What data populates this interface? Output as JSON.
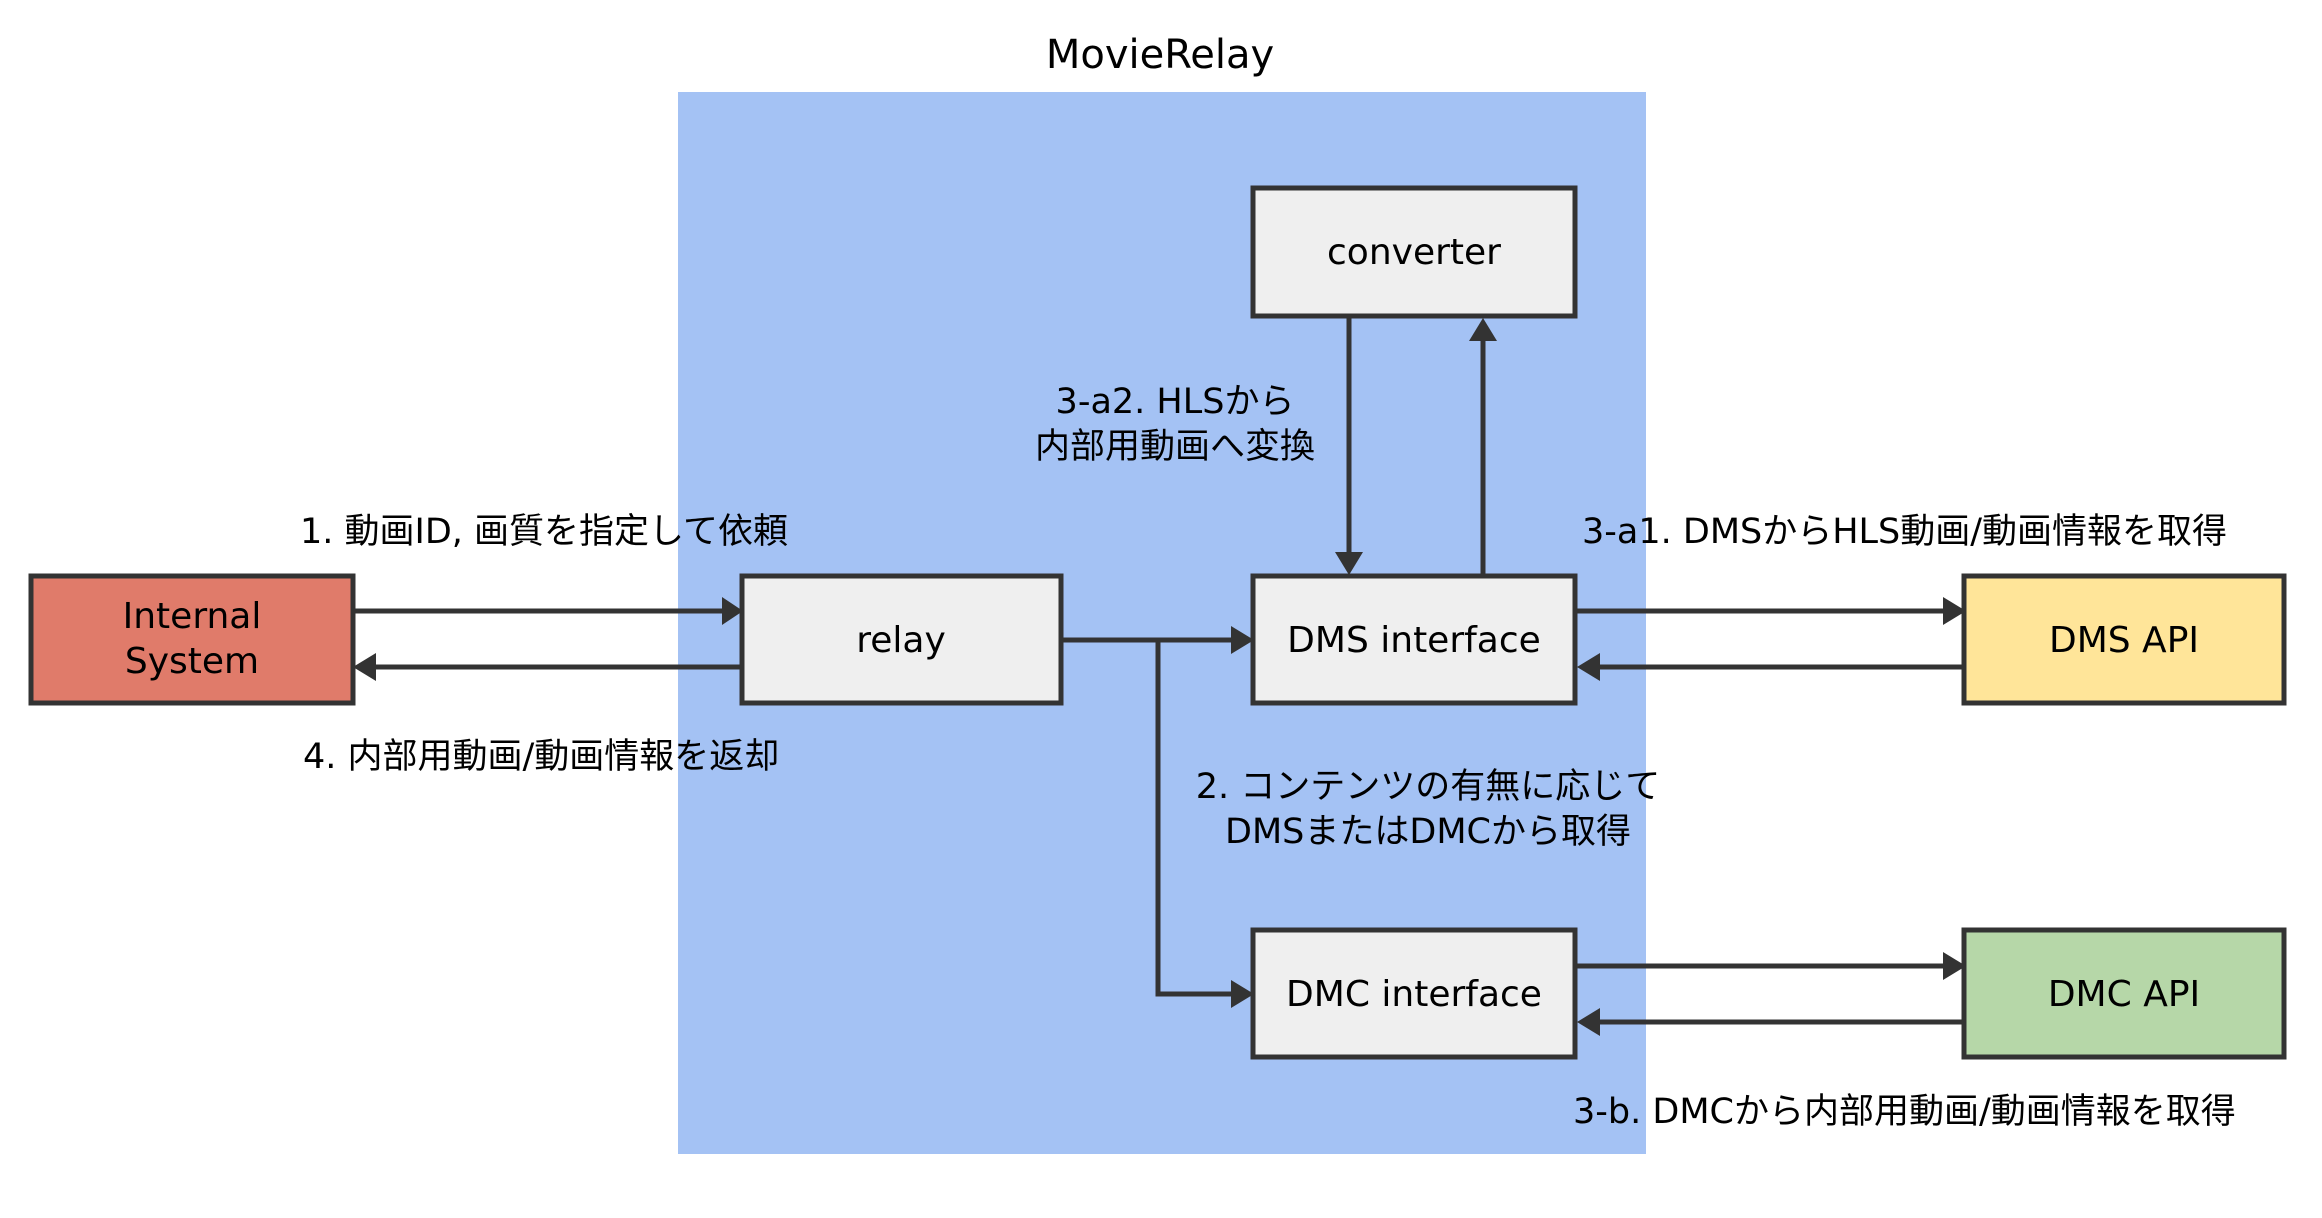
{
  "diagram": {
    "title": "MovieRelay",
    "colors": {
      "container_fill": "#a4c2f4",
      "box_fill": "#efefef",
      "internal_fill": "#e07b6a",
      "dms_api_fill": "#ffe599",
      "dmc_api_fill": "#b6d7a8",
      "line": "#333333"
    },
    "nodes": {
      "internal_system": {
        "line1": "Internal",
        "line2": "System"
      },
      "relay": {
        "label": "relay"
      },
      "converter": {
        "label": "converter"
      },
      "dms_interface": {
        "label": "DMS interface"
      },
      "dmc_interface": {
        "label": "DMC interface"
      },
      "dms_api": {
        "label": "DMS API"
      },
      "dmc_api": {
        "label": "DMC API"
      }
    },
    "edges": {
      "step1": "1. 動画ID, 画質を指定して依頼",
      "step4": "4. 内部用動画/動画情報を返却",
      "step2_line1": "2. コンテンツの有無に応じて",
      "step2_line2": "DMSまたはDMCから取得",
      "step3a1": "3-a1. DMSからHLS動画/動画情報を取得",
      "step3a2_line1": "3-a2. HLSから",
      "step3a2_line2": "内部用動画へ変換",
      "step3b": "3-b. DMCから内部用動画/動画情報を取得"
    }
  }
}
